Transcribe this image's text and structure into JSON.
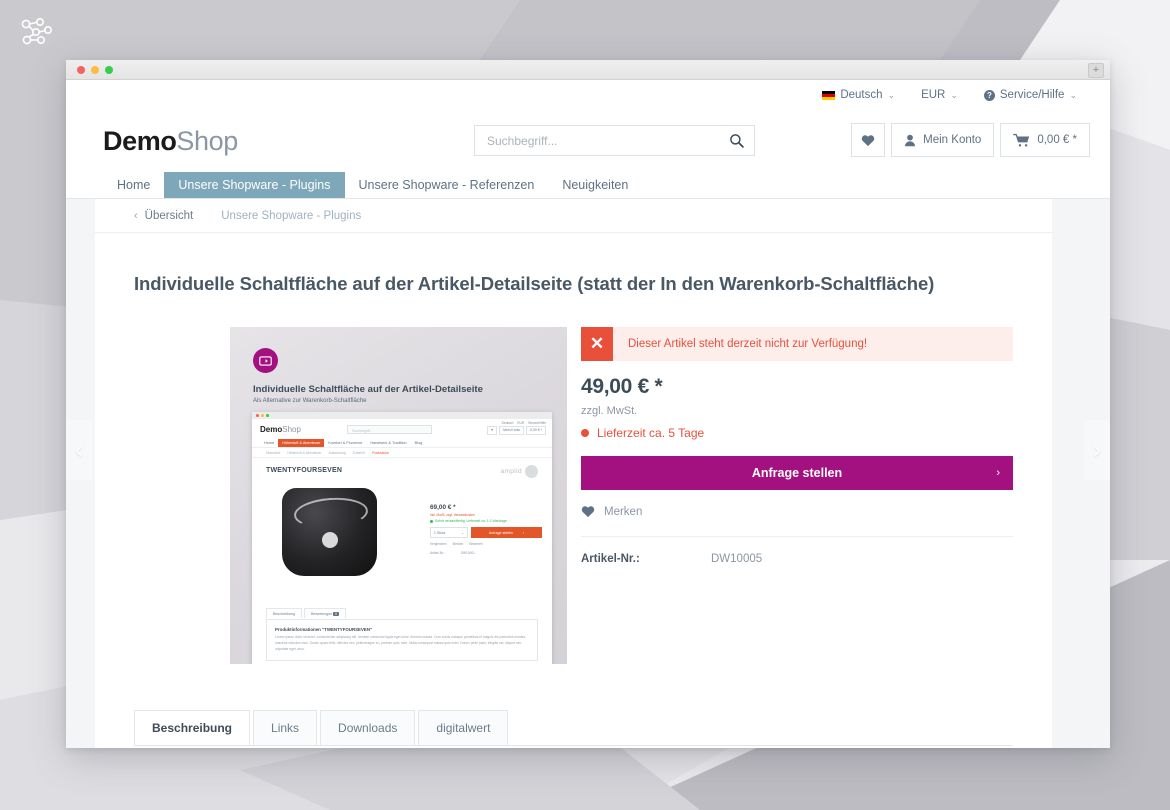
{
  "browser": {
    "newtab_label": "+"
  },
  "shop": {
    "topbar": {
      "language": "Deutsch",
      "currency": "EUR",
      "service": "Service/Hilfe",
      "caret": "⌄"
    },
    "logo": {
      "bold": "Demo",
      "light": "Shop"
    },
    "search": {
      "placeholder": "Suchbegriff...",
      "value": "",
      "icon": "search-icon"
    },
    "actions": {
      "wishlist_icon": "heart-icon",
      "account_label": "Mein Konto",
      "cart_label": "0,00 € *"
    },
    "nav": [
      {
        "label": "Home",
        "active": false
      },
      {
        "label": "Unsere Shopware - Plugins",
        "active": true
      },
      {
        "label": "Unsere Shopware - Referenzen",
        "active": false
      },
      {
        "label": "Neuigkeiten",
        "active": false
      }
    ],
    "nav_active_color": "#7ea7b9"
  },
  "breadcrumb": {
    "back_label": "Übersicht",
    "category_label": "Unsere Shopware - Plugins"
  },
  "product": {
    "title": "Individuelle Schaltfläche auf der Artikel-Detailseite (statt der In den Warenkorb-Schaltfläche)",
    "error_notice": "Dieser Artikel steht derzeit nicht zur Verfügung!",
    "error_icon": "close-x-icon",
    "error_color": "#e8503a",
    "price": "49,00 € *",
    "tax_note": "zzgl. MwSt.",
    "delivery": "Lieferzeit ca. 5 Tage",
    "cta_label": "Anfrage stellen",
    "cta_arrow": "›",
    "cta_color": "#a3107f",
    "remember_label": "Merken",
    "artnr_label": "Artikel-Nr.:",
    "artnr_value": "DW10005"
  },
  "product_image": {
    "badge_icon": "screen-play-icon",
    "headline": "Individuelle Schaltfläche auf der Artikel-Detailseite",
    "subline": "Als Alternative zur Warenkorb-Schaltfläche",
    "inner": {
      "logo_bold": "Demo",
      "logo_light": "Shop",
      "search_placeholder": "Suchbegriff...",
      "topbar": [
        "Deutsch",
        "EUR",
        "Service/Hilfe"
      ],
      "account_label": "Mein Konto",
      "cart_label": "0,00 € *",
      "nav": [
        {
          "label": "Home",
          "active": false
        },
        {
          "label": "Höhenluft & Abenteuer",
          "active": true
        },
        {
          "label": "Komfort & Provence",
          "active": false
        },
        {
          "label": "Handwerk & Tradition",
          "active": false
        },
        {
          "label": "Blog",
          "active": false
        }
      ],
      "crumbs": [
        "Übersicht",
        "Höhenluft & Abenteuer",
        "Ausrüstung",
        "Zubehör",
        "Rucksäcke"
      ],
      "product_title": "TWENTYFOURSEVEN",
      "brand": "amplid",
      "price": "69,00 € *",
      "tax_note": "inkl. MwSt. zzgl. Versandkosten",
      "availability": "Sofort versandfertig, Lieferzeit ca. 1-3 Werktage",
      "qty": "1 Stück",
      "cta_label": "Anfrage stellen",
      "links": [
        "Vergleichen",
        "Merken",
        "Bewerten"
      ],
      "artnr_label": "Artikel-Nr.:",
      "artnr_value": "SW10001",
      "tabs": [
        "Beschreibung",
        "Bewertungen"
      ],
      "tab_badge": "0",
      "desc_title": "Produktinformationen \"TWENTYFOURSEVEN\"",
      "desc_body": "Lorem ipsum dolor sit amet, consectetuer adipiscing elit. Aenean commodo ligula eget dolor. Aenean massa. Cum sociis natoque penatibus et magnis dis parturient montes, nascetur ridiculus mus. Donec quam felis, ultricies nec, pellentesque eu, pretium quis, sem. Nulla consequat massa quis enim. Donec pede justo, fringilla vel, aliquet nec, vulputate eget, arcu."
    }
  },
  "tabs": [
    {
      "label": "Beschreibung",
      "active": true
    },
    {
      "label": "Links",
      "active": false
    },
    {
      "label": "Downloads",
      "active": false
    },
    {
      "label": "digitalwert",
      "active": false
    }
  ],
  "carousel": {
    "prev": "‹",
    "next": "›"
  }
}
